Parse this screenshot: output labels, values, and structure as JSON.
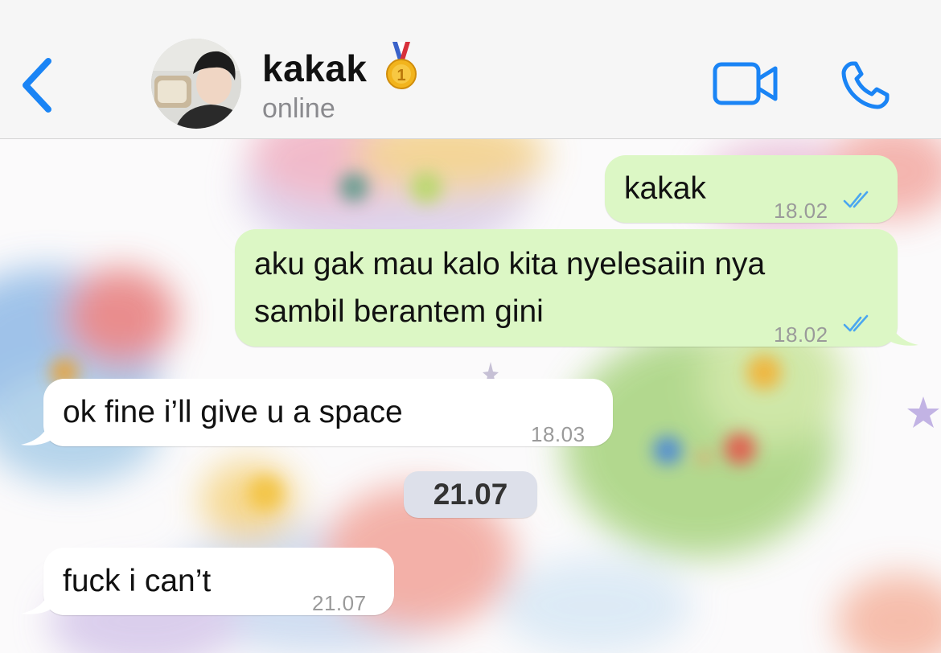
{
  "header": {
    "contact_name": "kakak",
    "status": "online",
    "icons": {
      "back": "chevron-left-icon",
      "medal": "first-place-medal-icon",
      "video": "video-camera-icon",
      "call": "phone-icon"
    },
    "accent_color": "#1a84f5"
  },
  "messages": [
    {
      "direction": "out",
      "text": "kakak",
      "time": "18.02",
      "status": "read"
    },
    {
      "direction": "out",
      "lines": [
        "aku gak mau kalo kita nyelesaiin nya",
        "sambil berantem gini"
      ],
      "time": "18.02",
      "status": "read"
    },
    {
      "direction": "in",
      "text": "ok fine i’ll give u a space",
      "time": "18.03"
    },
    {
      "direction": "in",
      "text": "fuck i can’t",
      "time": "21.07"
    }
  ],
  "date_separator": "21.07",
  "colors": {
    "outgoing_bubble": "#dcf7c5",
    "incoming_bubble": "#ffffff",
    "read_ticks": "#4aa6f0",
    "date_pill": "#dde0ea"
  }
}
